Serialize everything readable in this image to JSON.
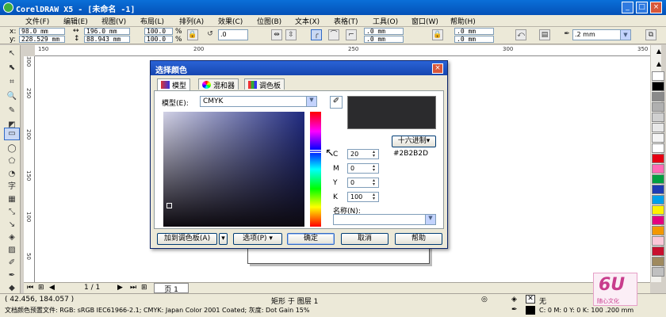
{
  "window": {
    "title": "CorelDRAW X5 - [未命名 -1]",
    "controls": [
      "_",
      "□",
      "×"
    ]
  },
  "menu": [
    "文件(F)",
    "编辑(E)",
    "视图(V)",
    "布局(L)",
    "排列(A)",
    "效果(C)",
    "位图(B)",
    "文本(X)",
    "表格(T)",
    "工具(O)",
    "窗口(W)",
    "帮助(H)"
  ],
  "propbar": {
    "x_label": "x:",
    "x_value": "98.0 mm",
    "y_label": "y:",
    "y_value": "228.529 mm",
    "w_value": "196.0 mm",
    "h_value": "88.943 mm",
    "scale_w": "100.0",
    "scale_h": "100.0",
    "percent": "%",
    "rotate": ".0",
    "corner1": ".0 mm",
    "corner2": ".0 mm",
    "corner3": ".0 mm",
    "corner4": ".0 mm",
    "outline": ".2 mm"
  },
  "ruler": {
    "top": [
      "150",
      "200",
      "250",
      "300",
      "350"
    ],
    "left": [
      "300",
      "250",
      "200",
      "150",
      "100",
      "50"
    ]
  },
  "dialog": {
    "title": "选择颜色",
    "close": "×",
    "tabs": [
      "模型",
      "混和器",
      "调色板"
    ],
    "model_label": "模型(E):",
    "model_value": "CMYK",
    "hex_button": "十六进制▾",
    "hex_value": "#2B2B2D",
    "preview_color": "#2b2b2d",
    "c_label": "C",
    "c_value": "20",
    "m_label": "M",
    "m_value": "0",
    "y_label": "Y",
    "y_value": "0",
    "k_label": "K",
    "k_value": "100",
    "name_label": "名称(N):",
    "name_value": "",
    "add_palette": "加到调色板(A)",
    "options": "选项(P) ▾",
    "ok": "确定",
    "cancel": "取消",
    "help": "帮助"
  },
  "pagenav": {
    "count": "1 / 1",
    "tab": "页 1"
  },
  "status": {
    "coords": "( 42.456, 184.057 )",
    "object": "矩形 于 图层 1",
    "profile": "文档颜色预置文件: RGB: sRGB IEC61966-2.1; CMYK: Japan Color 2001 Coated; 灰度: Dot Gain 15%",
    "fill_none": "无",
    "outline_info": "C: 0 M: 0 Y: 0 K: 100  .200 mm"
  },
  "watermark": {
    "text": "随心文化"
  },
  "palette_colors": [
    "#ffffff",
    "#000000",
    "#8a8a8a",
    "#b0b0b0",
    "#d0d0d0",
    "#e8e8e8",
    "#f4f4f4",
    "#ffffff",
    "#e60012",
    "#ff69b4",
    "#00a040",
    "#1e3cb4",
    "#00a0e9",
    "#fff100",
    "#e4007f",
    "#f39800",
    "#fbc8d8",
    "#c8102e",
    "#9f8a5e",
    "#c0c0c0"
  ]
}
